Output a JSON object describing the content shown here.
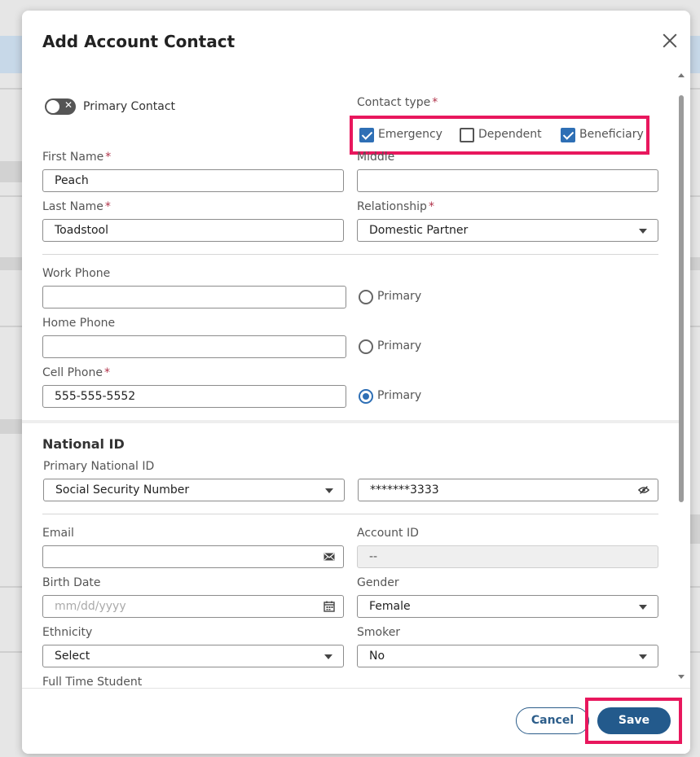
{
  "modal": {
    "title": "Add Account Contact",
    "primary_contact_label": "Primary Contact",
    "contact_type_label": "Contact type",
    "contact_types": [
      {
        "label": "Emergency",
        "checked": true
      },
      {
        "label": "Dependent",
        "checked": false
      },
      {
        "label": "Beneficiary",
        "checked": true
      }
    ],
    "first_name": {
      "label": "First Name",
      "value": "Peach"
    },
    "middle": {
      "label": "Middle",
      "value": ""
    },
    "last_name": {
      "label": "Last Name",
      "value": "Toadstool"
    },
    "relationship": {
      "label": "Relationship",
      "value": "Domestic Partner"
    },
    "work_phone": {
      "label": "Work Phone",
      "value": "",
      "primary_label": "Primary",
      "primary": false
    },
    "home_phone": {
      "label": "Home Phone",
      "value": "",
      "primary_label": "Primary",
      "primary": false
    },
    "cell_phone": {
      "label": "Cell Phone",
      "value": "555-555-5552",
      "primary_label": "Primary",
      "primary": true
    },
    "national_id_section": "National ID",
    "primary_national_id": {
      "label": "Primary National ID",
      "value": "Social Security Number"
    },
    "national_id_value": "*******3333",
    "email": {
      "label": "Email",
      "value": ""
    },
    "account_id": {
      "label": "Account ID",
      "value": "--"
    },
    "birth_date": {
      "label": "Birth Date",
      "placeholder": "mm/dd/yyyy"
    },
    "gender": {
      "label": "Gender",
      "value": "Female"
    },
    "ethnicity": {
      "label": "Ethnicity",
      "value": "Select"
    },
    "smoker": {
      "label": "Smoker",
      "value": "No"
    },
    "full_time_student": {
      "label": "Full Time Student"
    },
    "required_mark": "*"
  },
  "footer": {
    "cancel_label": "Cancel",
    "save_label": "Save"
  },
  "colors": {
    "accent": "#2e6fb5",
    "primary_button": "#235a8c",
    "highlight": "#e8175d",
    "required": "#b0334a"
  }
}
